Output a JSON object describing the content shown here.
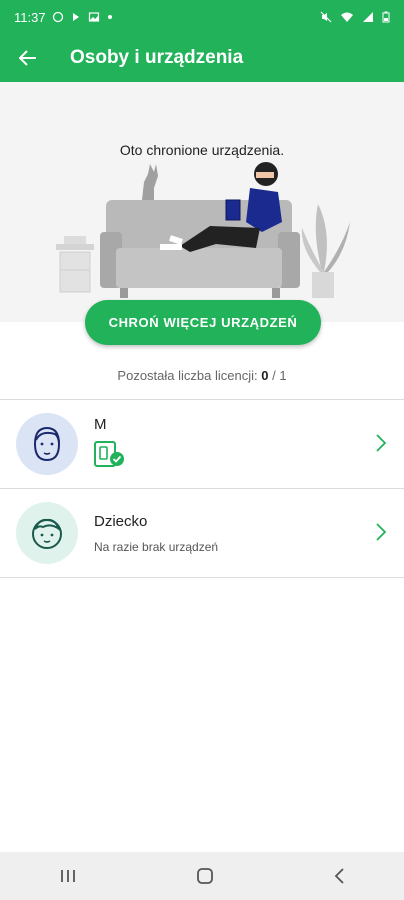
{
  "status_bar": {
    "time": "11:37",
    "left_icons": [
      "whatsapp-icon",
      "signal-app-icon",
      "image-icon",
      "dot-icon"
    ],
    "right_icons": [
      "mute-icon",
      "wifi-icon",
      "signal-icon",
      "battery-icon"
    ]
  },
  "app_bar": {
    "title": "Osoby i urządzenia",
    "back_icon": "arrow-back-icon"
  },
  "hero": {
    "caption": "Oto chronione urządzenia."
  },
  "cta": {
    "label": "CHROŃ WIĘCEJ URZĄDZEŃ"
  },
  "licenses": {
    "label": "Pozostała liczba licencji:",
    "used": "0",
    "separator": "/",
    "total": "1"
  },
  "people": [
    {
      "name": "M",
      "status": "",
      "avatar": "adult-face-icon",
      "device_icon": "device-protected-icon"
    },
    {
      "name": "Dziecko",
      "status": "Na razie brak urządzeń",
      "avatar": "child-face-icon"
    }
  ],
  "colors": {
    "brand": "#21b25a",
    "adult_avatar_bg": "#dbe4f5",
    "child_avatar_bg": "#dff3ec"
  },
  "nav": {
    "icons": [
      "recents-icon",
      "home-icon",
      "back-icon"
    ]
  }
}
